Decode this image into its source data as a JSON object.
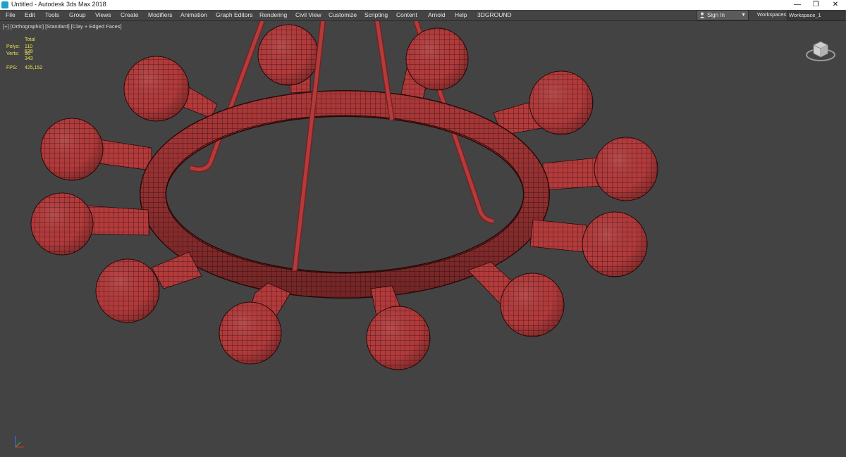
{
  "window": {
    "title": "Untitled - Autodesk 3ds Max 2018",
    "minimize": "—",
    "restore": "❐",
    "close": "✕"
  },
  "menu": [
    "File",
    "Edit",
    "Tools",
    "Group",
    "Views",
    "Create",
    "Modifiers",
    "Animation",
    "Graph Editors",
    "Rendering",
    "Civil View",
    "Customize",
    "Scripting",
    "Content",
    "Arnold",
    "Help",
    "3DGROUND"
  ],
  "account": {
    "sign_in": "Sign In"
  },
  "workspaces": {
    "label": "Workspaces:",
    "selected": "Workspace_1"
  },
  "viewport": {
    "labels": [
      "[+]",
      "[Orthographic]",
      "[Standard]",
      "[Clay + Edged Faces]"
    ],
    "stats": {
      "header": "Total",
      "polys_label": "Polys:",
      "polys": "110 528",
      "verts_label": "Verts:",
      "verts": "56 343",
      "fps_label": "FPS:",
      "fps": "425,152"
    }
  },
  "colors": {
    "mesh": "#b23b3c",
    "wire": "#2a0808",
    "viewport_bg": "#434343",
    "stats_text": "#e9e04e"
  },
  "icons": [
    "app-icon",
    "user-icon",
    "viewcube-icon",
    "axis-tripod-icon"
  ]
}
